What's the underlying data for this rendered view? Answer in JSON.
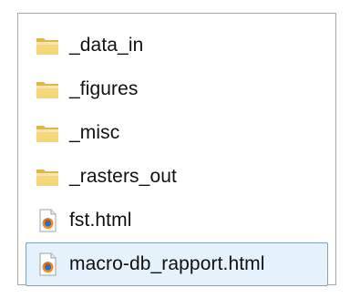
{
  "file_list": {
    "items": [
      {
        "name": "_data_in",
        "type": "folder",
        "icon": "folder-icon",
        "selected": false
      },
      {
        "name": "_figures",
        "type": "folder",
        "icon": "folder-icon",
        "selected": false
      },
      {
        "name": "_misc",
        "type": "folder",
        "icon": "folder-icon",
        "selected": false
      },
      {
        "name": "_rasters_out",
        "type": "folder",
        "icon": "folder-icon",
        "selected": false
      },
      {
        "name": "fst.html",
        "type": "html-file",
        "icon": "firefox-html-file-icon",
        "selected": false
      },
      {
        "name": "macro-db_rapport.html",
        "type": "html-file",
        "icon": "firefox-html-file-icon",
        "selected": true
      }
    ]
  },
  "colors": {
    "folder_yellow": "#f2cc6a",
    "selection_bg": "#e5f1fb",
    "selection_border": "#7da2ce"
  }
}
